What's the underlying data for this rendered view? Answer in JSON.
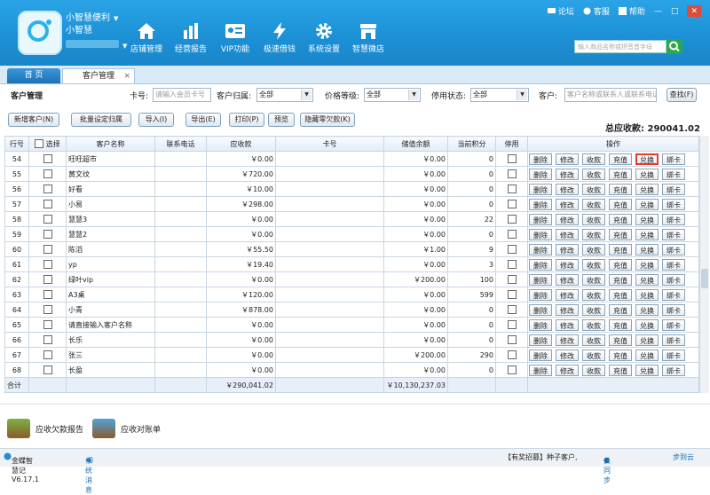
{
  "header": {
    "brand_line1": "小智慧便利",
    "brand_line2": "小智慧",
    "nav": [
      {
        "label": "店铺管理",
        "icon": "home-icon"
      },
      {
        "label": "经营报告",
        "icon": "bar-chart-icon"
      },
      {
        "label": "VIP功能",
        "icon": "vip-card-icon"
      },
      {
        "label": "极速借钱",
        "icon": "lightning-icon"
      },
      {
        "label": "系统设置",
        "icon": "gear-icon"
      },
      {
        "label": "智慧微店",
        "icon": "shop-icon"
      }
    ],
    "links": {
      "forum": "论坛",
      "service": "客服",
      "help": "帮助"
    },
    "search_placeholder": "输入商品名称或拼音首字母"
  },
  "tabs": {
    "home": "首 页",
    "customer": "客户管理",
    "close": "×"
  },
  "filter": {
    "section_title": "客户管理",
    "card_label": "卡号:",
    "card_placeholder": "请输入会员卡号",
    "group_label": "客户归属:",
    "group_value": "全部",
    "level_label": "价格等级:",
    "level_value": "全部",
    "status_label": "停用状态:",
    "status_value": "全部",
    "customer_label": "客户:",
    "customer_placeholder": "客户名称或联系人或联系电话",
    "search_btn": "查找(F)"
  },
  "actions": {
    "new": "新增客户(N)",
    "batch": "批量设定归属",
    "import": "导入(I)",
    "export": "导出(E)",
    "print": "打印(P)",
    "preview": "预览",
    "hide_zero": "隐藏零欠款(K)",
    "total_label": "总应收款:",
    "total_value": "290041.02"
  },
  "table": {
    "headers": {
      "no": "行号",
      "select": "选择",
      "name": "客户名称",
      "phone": "联系电话",
      "receivable": "应收款",
      "card": "卡号",
      "balance": "储值余额",
      "points": "当前积分",
      "disabled": "停用",
      "ops": "操作"
    },
    "op_labels": [
      "删除",
      "修改",
      "收款",
      "充值",
      "兑换",
      "绑卡"
    ],
    "rows": [
      {
        "no": "54",
        "name": "旺旺超市",
        "receivable": "￥0.00",
        "balance": "￥0.00",
        "points": "0"
      },
      {
        "no": "55",
        "name": "黄文纹",
        "receivable": "￥720.00",
        "balance": "￥0.00",
        "points": "0"
      },
      {
        "no": "56",
        "name": "好看",
        "receivable": "￥10.00",
        "balance": "￥0.00",
        "points": "0"
      },
      {
        "no": "57",
        "name": "小易",
        "receivable": "￥298.00",
        "balance": "￥0.00",
        "points": "0"
      },
      {
        "no": "58",
        "name": "慧慧3",
        "receivable": "￥0.00",
        "balance": "￥0.00",
        "points": "22"
      },
      {
        "no": "59",
        "name": "慧慧2",
        "receivable": "￥0.00",
        "balance": "￥0.00",
        "points": "0"
      },
      {
        "no": "60",
        "name": "陈滔",
        "receivable": "￥55.50",
        "balance": "￥1.00",
        "points": "9"
      },
      {
        "no": "61",
        "name": "yp",
        "receivable": "￥19.40",
        "balance": "￥0.00",
        "points": "3"
      },
      {
        "no": "62",
        "name": "绿叶vip",
        "receivable": "￥0.00",
        "balance": "￥200.00",
        "points": "100"
      },
      {
        "no": "63",
        "name": "A3桌",
        "receivable": "￥120.00",
        "balance": "￥0.00",
        "points": "599"
      },
      {
        "no": "64",
        "name": "小青",
        "receivable": "￥878.00",
        "balance": "￥0.00",
        "points": "0"
      },
      {
        "no": "65",
        "name": "请直接输入客户名称",
        "receivable": "￥0.00",
        "balance": "￥0.00",
        "points": "0"
      },
      {
        "no": "66",
        "name": "长乐",
        "receivable": "￥0.00",
        "balance": "￥0.00",
        "points": "0"
      },
      {
        "no": "67",
        "name": "张三",
        "receivable": "￥0.00",
        "balance": "￥200.00",
        "points": "290"
      },
      {
        "no": "68",
        "name": "长盈",
        "receivable": "￥0.00",
        "balance": "￥0.00",
        "points": "0"
      }
    ],
    "sum_label": "合计",
    "sum_receivable": "￥290,041.02",
    "sum_balance": "￥10,130,237.03"
  },
  "bottom": {
    "report": "应收欠款报告",
    "statement": "应收对账单"
  },
  "status": {
    "version": "金蝶智慧记V6.17.1",
    "msg": "系统消息",
    "ad": "【有奖招募】种子客户,",
    "sync": "云同步",
    "sync_tail": "步到云"
  },
  "colors": {
    "header": "#1c8fd4",
    "highlight": "#e23b2b"
  }
}
